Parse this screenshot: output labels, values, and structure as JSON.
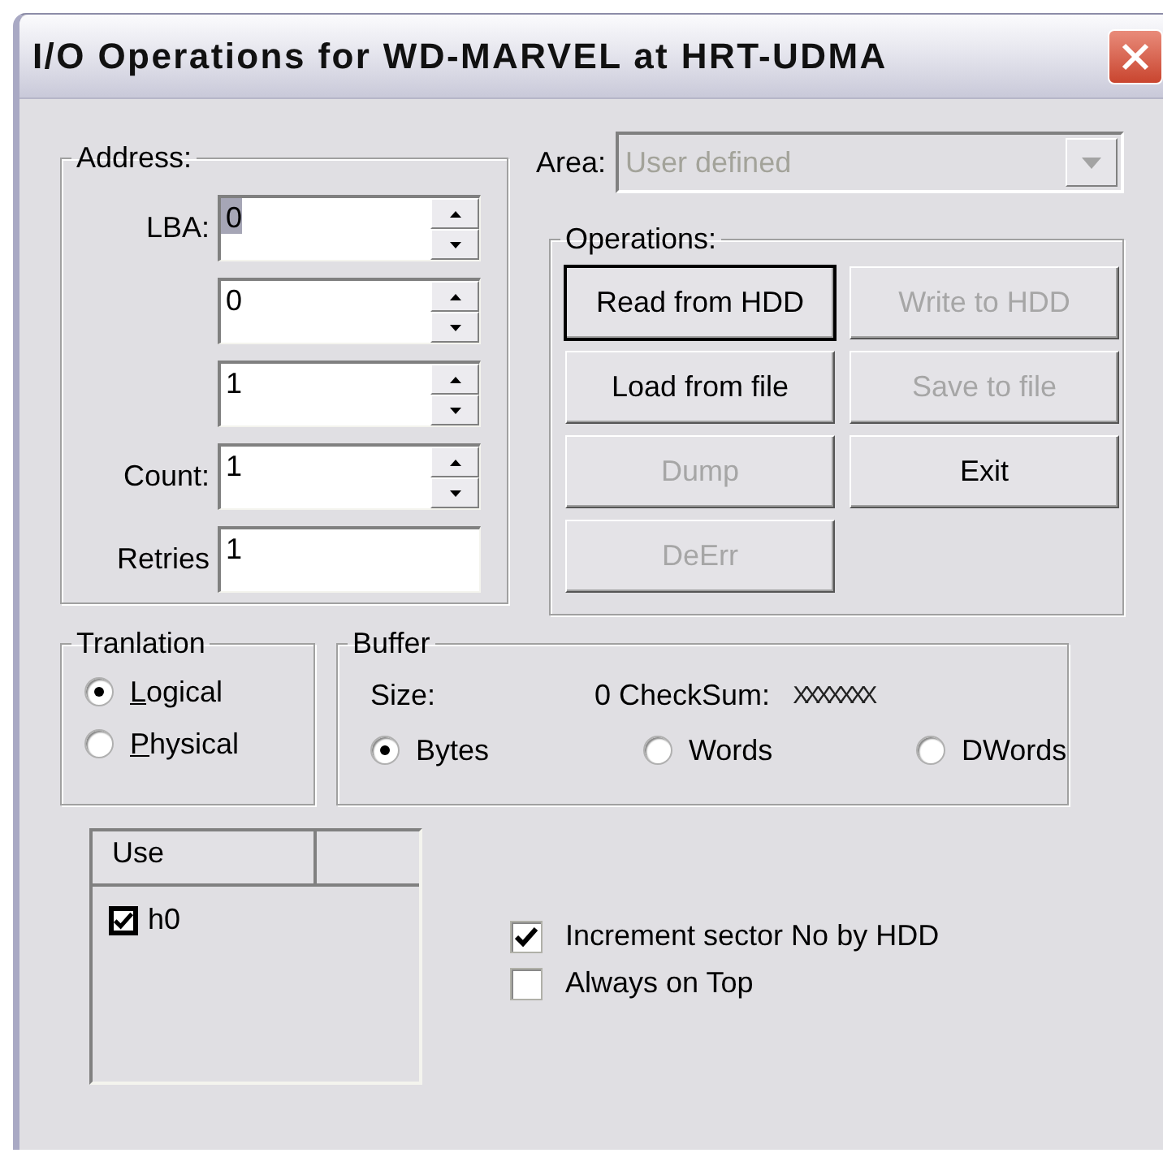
{
  "window": {
    "title": "I/O Operations for WD-MARVEL at HRT-UDMA"
  },
  "address": {
    "title": "Address:",
    "fields": [
      {
        "label": "LBA:",
        "value": "0",
        "kind": "spin",
        "selected": true
      },
      {
        "value": "0",
        "kind": "spin",
        "selected": false
      },
      {
        "value": "1",
        "kind": "spin",
        "selected": false
      },
      {
        "label": "Count:",
        "value": "1",
        "kind": "spin",
        "selected": false
      },
      {
        "label": "Retries",
        "value": "1",
        "kind": "text",
        "selected": false
      }
    ]
  },
  "area": {
    "label": "Area:",
    "value": "User defined",
    "disabled": true
  },
  "operations": {
    "title": "Operations:",
    "buttons": [
      {
        "label": "Read from HDD",
        "disabled": false,
        "focused": true
      },
      {
        "label": "Write to HDD",
        "disabled": true,
        "focused": false
      },
      {
        "label": "Load from file",
        "disabled": false,
        "focused": false
      },
      {
        "label": "Save to file",
        "disabled": true,
        "focused": false
      },
      {
        "label": "Dump",
        "disabled": true,
        "focused": false
      },
      {
        "label": "Exit",
        "disabled": false,
        "focused": false
      },
      {
        "label": "DeErr",
        "disabled": true,
        "focused": false
      }
    ]
  },
  "translation": {
    "title": "Tranlation",
    "options": [
      {
        "label": "Logical",
        "selected": true,
        "underline_first": true
      },
      {
        "label": "Physical",
        "selected": false,
        "underline_first": true
      }
    ]
  },
  "buffer": {
    "title": "Buffer",
    "size_label": "Size:",
    "size_value": "0",
    "checksum_label": "CheckSum:",
    "checksum_value": "XXXXXXX",
    "units": [
      {
        "label": "Bytes",
        "selected": true
      },
      {
        "label": "Words",
        "selected": false
      },
      {
        "label": "DWords",
        "selected": false
      }
    ]
  },
  "use_list": {
    "columns": [
      "Use"
    ],
    "items": [
      {
        "label": "h0",
        "checked": true
      }
    ]
  },
  "options": [
    {
      "label": "Increment sector No by HDD",
      "checked": true
    },
    {
      "label": "Always on Top",
      "checked": false
    }
  ]
}
